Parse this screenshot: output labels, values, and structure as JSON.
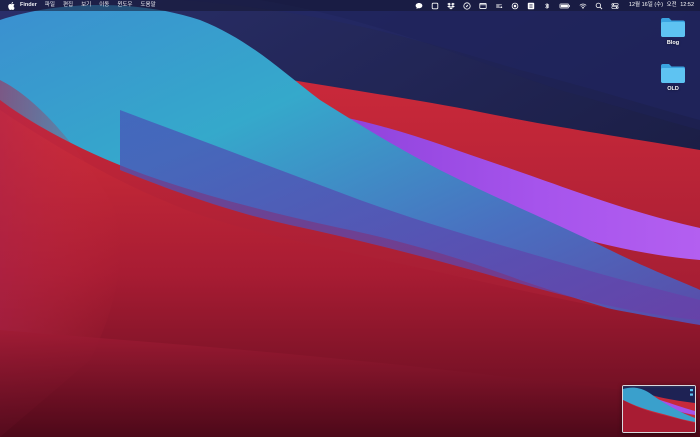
{
  "menubar": {
    "apple_icon": "apple-logo-icon",
    "app_name": "Finder",
    "menus": [
      "파일",
      "편집",
      "보기",
      "이동",
      "윈도우",
      "도움말"
    ],
    "tray_icons": [
      "message-icon",
      "stop-square-icon",
      "dropbox-icon",
      "compass-icon",
      "window-icon",
      "wifi-menu-icon",
      "record-icon",
      "grid-app-icon",
      "bluetooth-icon",
      "battery-icon",
      "wifi-icon",
      "search-icon",
      "control-center-icon"
    ],
    "clock": {
      "date": "12월 16일 (수)",
      "ampm": "오전",
      "time": "12:52"
    }
  },
  "desktop": {
    "icons": [
      {
        "name": "Blog",
        "icon": "folder-icon"
      },
      {
        "name": "OLD",
        "icon": "folder-icon"
      }
    ]
  },
  "thumbnail": {
    "icon": "screenshot-thumbnail"
  },
  "colors": {
    "folder": "#5ec3f2",
    "folder_tab": "#3aa3e0",
    "wallpaper_dark": "#1a1f4a",
    "wallpaper_red": "#c9253a",
    "wallpaper_cyan": "#32a8c8",
    "wallpaper_purple": "#a050e8"
  }
}
